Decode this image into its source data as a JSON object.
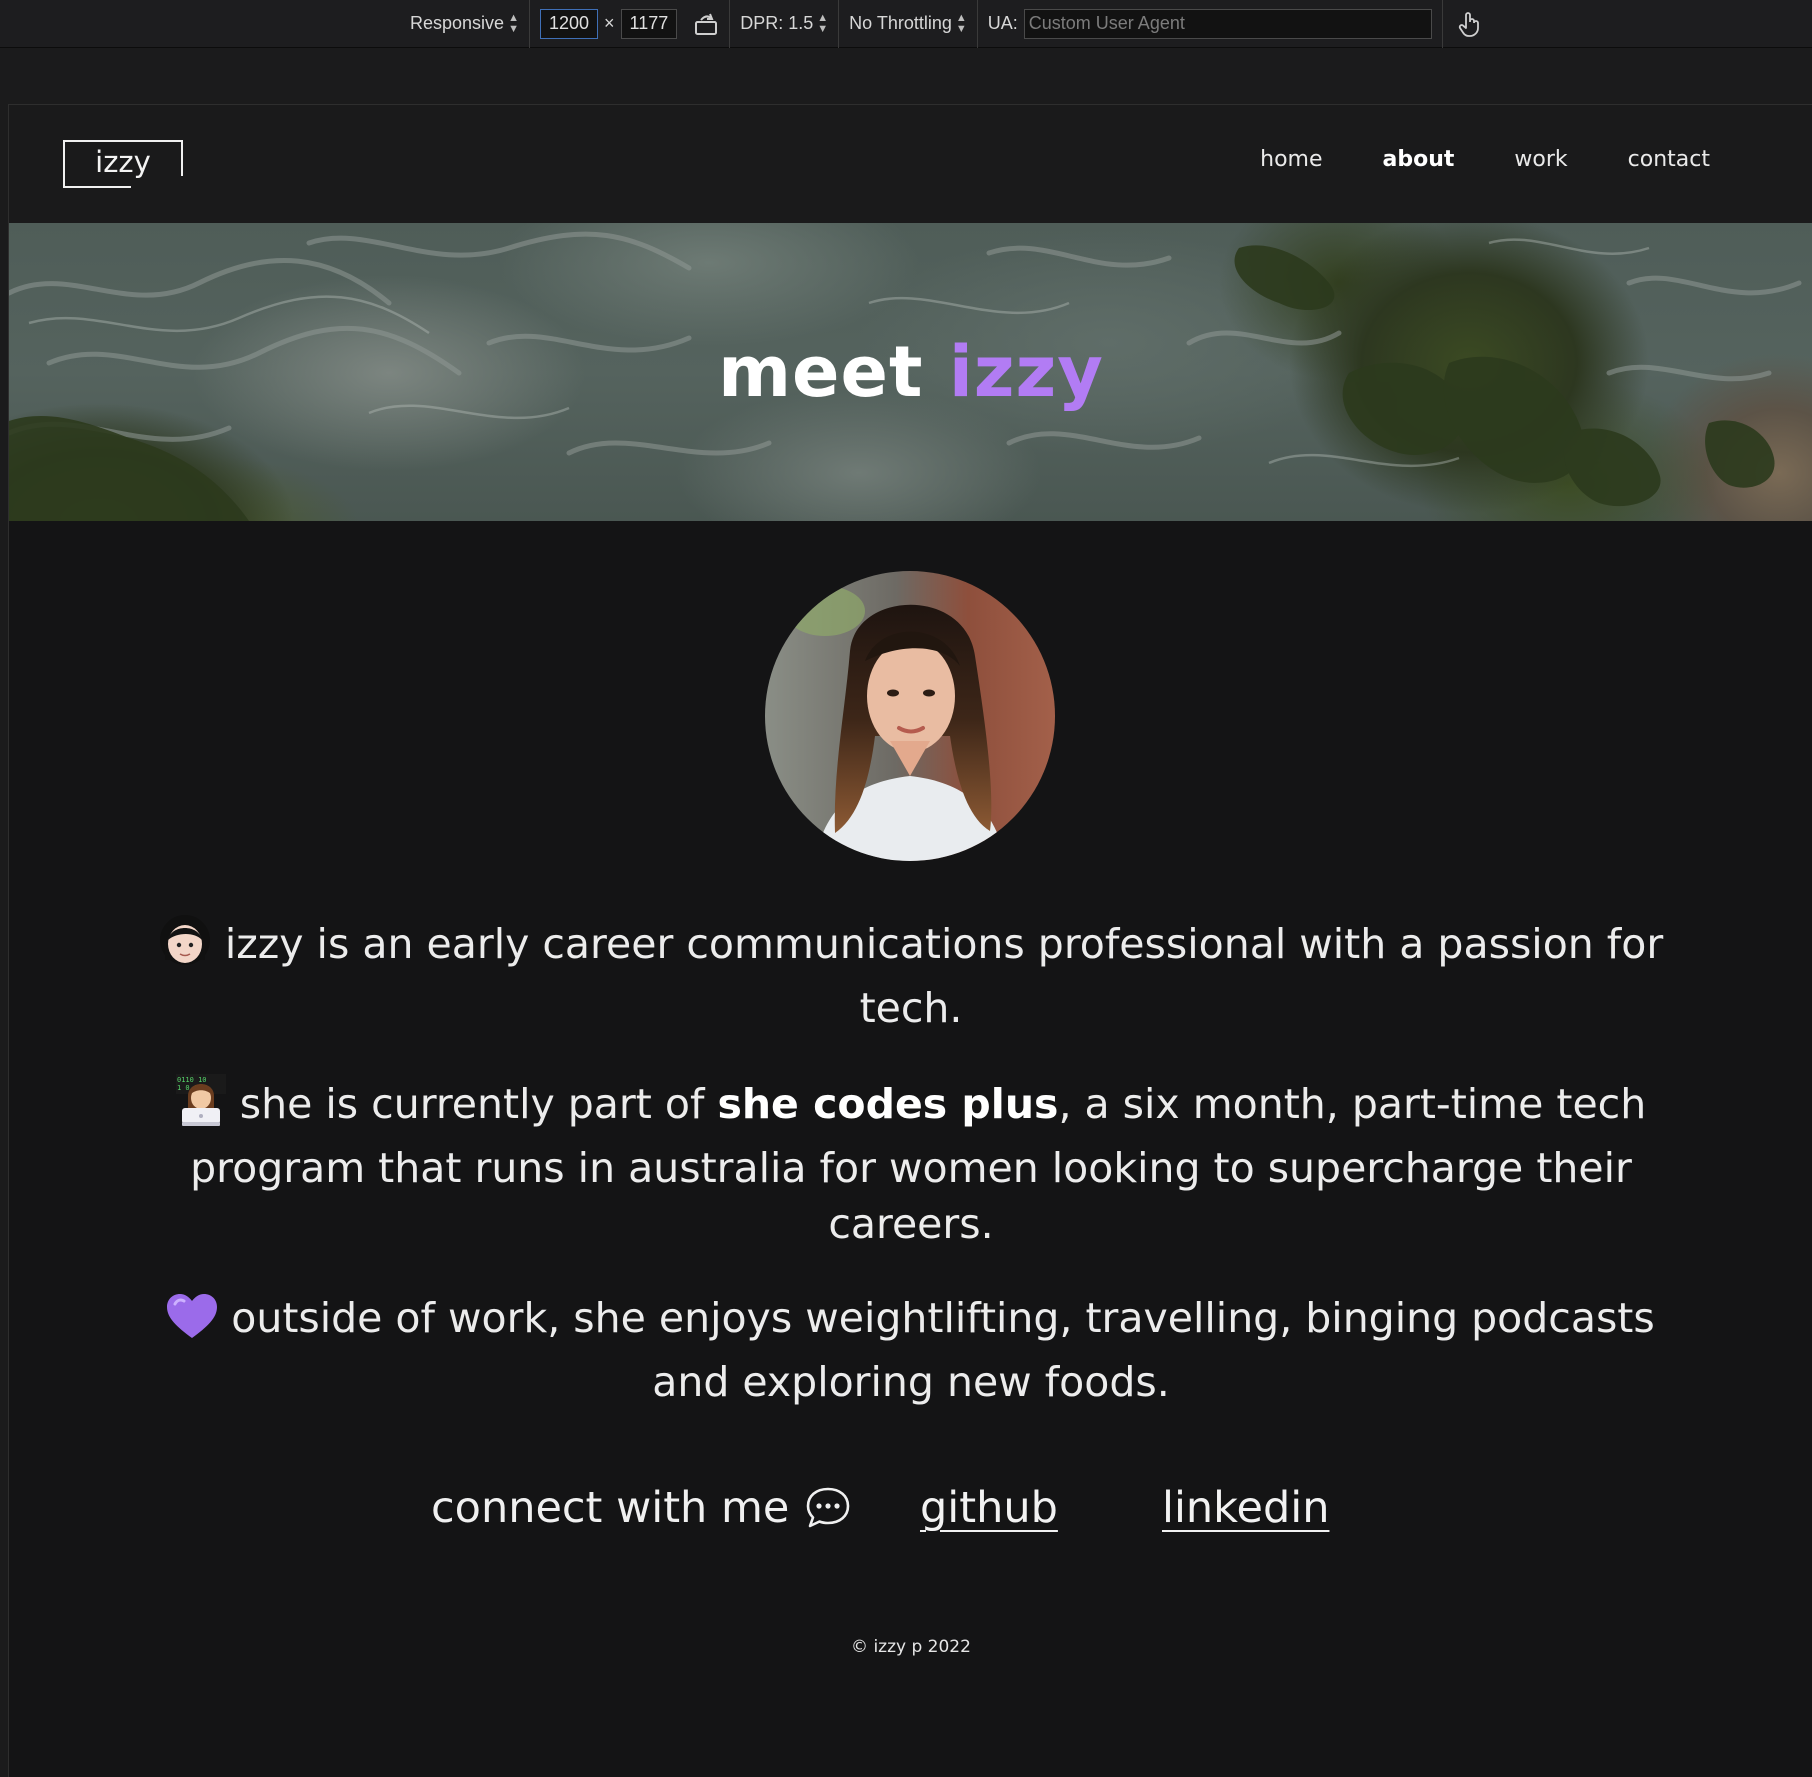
{
  "devtools": {
    "device": "Responsive",
    "width": "1200",
    "times": "×",
    "height": "1177",
    "dpr": "DPR: 1.5",
    "throttling": "No Throttling",
    "ua_label": "UA:",
    "ua_placeholder": "Custom User Agent"
  },
  "header": {
    "logo": "izzy",
    "nav": [
      {
        "label": "home",
        "current": false
      },
      {
        "label": "about",
        "current": true
      },
      {
        "label": "work",
        "current": false
      },
      {
        "label": "contact",
        "current": false
      }
    ]
  },
  "hero": {
    "title_prefix": "meet",
    "title_accent": "izzy"
  },
  "about": {
    "p1": "izzy is an early career communications professional with a passion for tech.",
    "p2_before": "she is currently part of",
    "p2_bold": "she codes plus",
    "p2_after": ", a six month, part-time tech program that runs in australia for women looking to supercharge their careers.",
    "p3": "outside of work, she enjoys weightlifting, travelling, binging podcasts and exploring new foods."
  },
  "connect": {
    "label": "connect with me",
    "links": [
      "github",
      "linkedin"
    ]
  },
  "footer": {
    "copyright": "© izzy p 2022"
  },
  "colors": {
    "accent": "#b27cf4",
    "page_background": "#141415",
    "header_background": "#1a1a1b",
    "heart": "#9b6bea"
  },
  "icons": {
    "rotate": "rotate-icon",
    "touch": "touch-hand-icon",
    "woman_emoji": "woman-emoji-icon",
    "technologist_emoji": "woman-technologist-emoji-icon",
    "heart_emoji": "purple-heart-emoji-icon",
    "speech": "speech-bubble-icon"
  }
}
